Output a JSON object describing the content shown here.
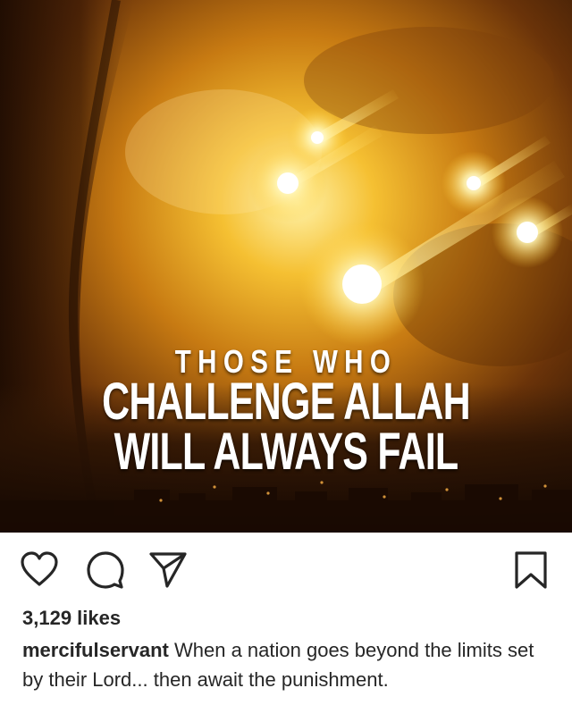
{
  "post": {
    "image": {
      "overlay_line1": "THOSE WHO",
      "overlay_line2": "CHALLENGE ALLAH",
      "overlay_line3": "WILL ALWAYS FAIL",
      "palette": [
        "#2a1405",
        "#7a3e08",
        "#e8a11c",
        "#fff6b0"
      ]
    },
    "actions": {
      "like_icon": "heart-icon",
      "comment_icon": "comment-icon",
      "share_icon": "paper-plane-icon",
      "save_icon": "bookmark-icon"
    },
    "likes_text": "3,129 likes",
    "caption": {
      "username": "mercifulservant",
      "text": "When a nation goes beyond the limits set by their Lord... then await the punishment."
    }
  }
}
